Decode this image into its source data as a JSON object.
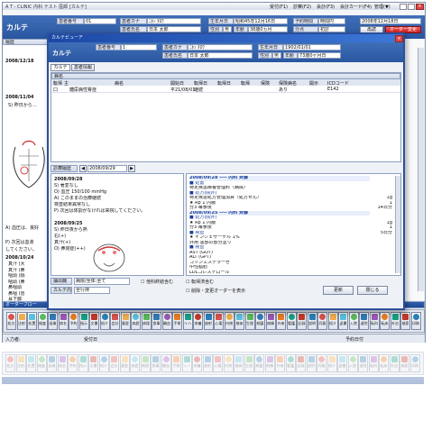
{
  "window": {
    "title": "A T - CLINIC  内科 テスト 医師 [カルテ]",
    "menu": [
      "受付(F1)",
      "診察(F2)",
      "会計(F3)",
      "会計カード(F4)",
      "管理(▼)"
    ],
    "date": "2008/12/18 (木)"
  },
  "header": {
    "karte_label": "カルテ",
    "patient_no_label": "患者番号",
    "patient_no": "01",
    "kana_label": "患者カナ",
    "kana": "ﾆﾎﾝ ﾀﾛｳ",
    "name_label": "患者氏名",
    "name": "日本 太郎",
    "birth_label": "生年月日",
    "birth": "昭和45年12月16日",
    "sex_label": "性別",
    "sex": "男",
    "age_label": "年齢",
    "age": "38歳0ヵ月",
    "reserve_label": "予約時間",
    "reserve_time": "時間円",
    "visit_label": "分点",
    "visit": "初診",
    "date_box": "2008年12月18日",
    "update_button": "再読",
    "order_button": "オーダー変更"
  },
  "left_pane": {
    "section_title": "履歴",
    "entries": [
      {
        "date": "2008/12/18",
        "text": ""
      },
      {
        "date": "2008/11/04",
        "text": "S) 昨日から…"
      },
      {
        "date": "2008/10/24",
        "text": "A) 血圧は、良好"
      }
    ],
    "notes": [
      "P) 次回は血液",
      "してください。"
    ],
    "list_items": [
      "真汁 (大",
      "真汁 (鼻",
      "咽頭 (隔",
      "咽頭 (鼻",
      "鼻咽頭",
      "鼻咽 (冒",
      "耳下腺",
      "耳下腺"
    ]
  },
  "order_bar": {
    "label": "オーダーフロー",
    "right_label": "オーダー",
    "tools": [
      "処方",
      "注射",
      "処置",
      "検査",
      "画像",
      "病名",
      "予約",
      "指示",
      "文書",
      "紹介",
      "会計",
      "薬歴",
      "病歴",
      "病理",
      "食事",
      "輸血",
      "手術",
      "リハ",
      "栄養",
      "放射",
      "心電",
      "内視",
      "検体",
      "生理",
      "細菌",
      "病棟",
      "外来",
      "看護",
      "記録",
      "説明",
      "同意",
      "紹介",
      "返書",
      "入院",
      "退院",
      "転科",
      "転床",
      "外泊",
      "検索",
      "印刷"
    ]
  },
  "dialog": {
    "title": "カルテビューア",
    "patient_no_label": "患者番号",
    "patient_no": "1",
    "kana_label": "患者カナ",
    "kana": "ﾆﾎﾝ ﾀﾛｳ",
    "birth_label": "生年月日",
    "birth": "1902/01/01",
    "name_label": "患者氏名",
    "name": "日本 太郎",
    "sex_label": "性別",
    "sex": "男",
    "age_label": "年齢",
    "age": "73歳0ヶ月日",
    "tabs": [
      "カルテ",
      "患者情報"
    ],
    "byomei_section": "病名",
    "byomei_headers": [
      "転帰",
      "主",
      "病名",
      "開始日",
      "転帰日",
      "転帰日",
      "転帰",
      "保険",
      "保険病名",
      "開示",
      "ICDコード"
    ],
    "byomei_rows": [
      {
        "flag": "口",
        "main": "",
        "name": "糖尿病性腎症",
        "start": "平21/08/01",
        "end": "継続",
        "col6": "",
        "col7": "",
        "col8": "",
        "ins": "あり",
        "disc": "",
        "icd": "E142"
      }
    ],
    "history_label": "診療履歴",
    "history_date": "2008/09/29",
    "soap_lines": [
      "2008/09/28",
      "S) 著変なし",
      "O) 血圧 150/100 mmHg",
      "A) このままの治療継続",
      "   検査結果異常なし",
      "P) 次回は体調がなければ来院してください。",
      "",
      "2008/09/25",
      "S) 昨日夜から熱",
      "   右(+)",
      "   真汁(+)",
      "O) 鼻閉症(++)"
    ],
    "orders": [
      {
        "head": "2008/09/28 ---- 内科 斉藤",
        "type": "head"
      },
      {
        "text": "■ 処置",
        "type": "cat"
      },
      {
        "text": "特定疾患療養管理料（病院）",
        "type": "item"
      },
      {
        "text": "■ 処方(院外)",
        "type": "cat"
      },
      {
        "text": "特定疾患処方管理加算（処方せん）",
        "type": "item"
      },
      {
        "text": "★ Rp 1 内服",
        "type": "item"
      },
      {
        "text": "  分3 毎食後",
        "type": "item"
      },
      {
        "head": "2008/09/25 ---- 内科 斉藤",
        "type": "head"
      },
      {
        "text": "■ 処方(院外)",
        "type": "cat"
      },
      {
        "text": "★ Rp 1 内服",
        "type": "item"
      },
      {
        "text": "  分3 毎食後",
        "type": "item"
      },
      {
        "text": "■ 検査",
        "type": "cat"
      },
      {
        "text": "★ インジェザーゲル 1%",
        "type": "item"
      },
      {
        "text": "  外用  患部の部分塗り",
        "type": "item"
      },
      {
        "text": "■ 検査",
        "type": "cat"
      },
      {
        "text": "AST (GOT)",
        "type": "item"
      },
      {
        "text": "ALT (GPT)",
        "type": "item"
      },
      {
        "text": "コリンエステラーゼ",
        "type": "item"
      },
      {
        "text": "中性脂肪",
        "type": "item"
      },
      {
        "text": "LDLコレステロール",
        "type": "item"
      }
    ],
    "order_qty": [
      "1g",
      "1",
      "14日分",
      "1g",
      "1",
      "5日分"
    ],
    "filter_label": "抽出欄",
    "filter_select": "病院/全体:全て",
    "filter_sub": "カルテ内容",
    "filter_all": "全行持",
    "opt1": "他科終結含む",
    "opt2": "転帰済含む",
    "opt3": "削除・変更オーダーを表示",
    "update_button": "更新",
    "close_button": "閉じる"
  },
  "status_bar": {
    "left": "入力者:",
    "mid": "受付日",
    "right": "予約日付"
  }
}
